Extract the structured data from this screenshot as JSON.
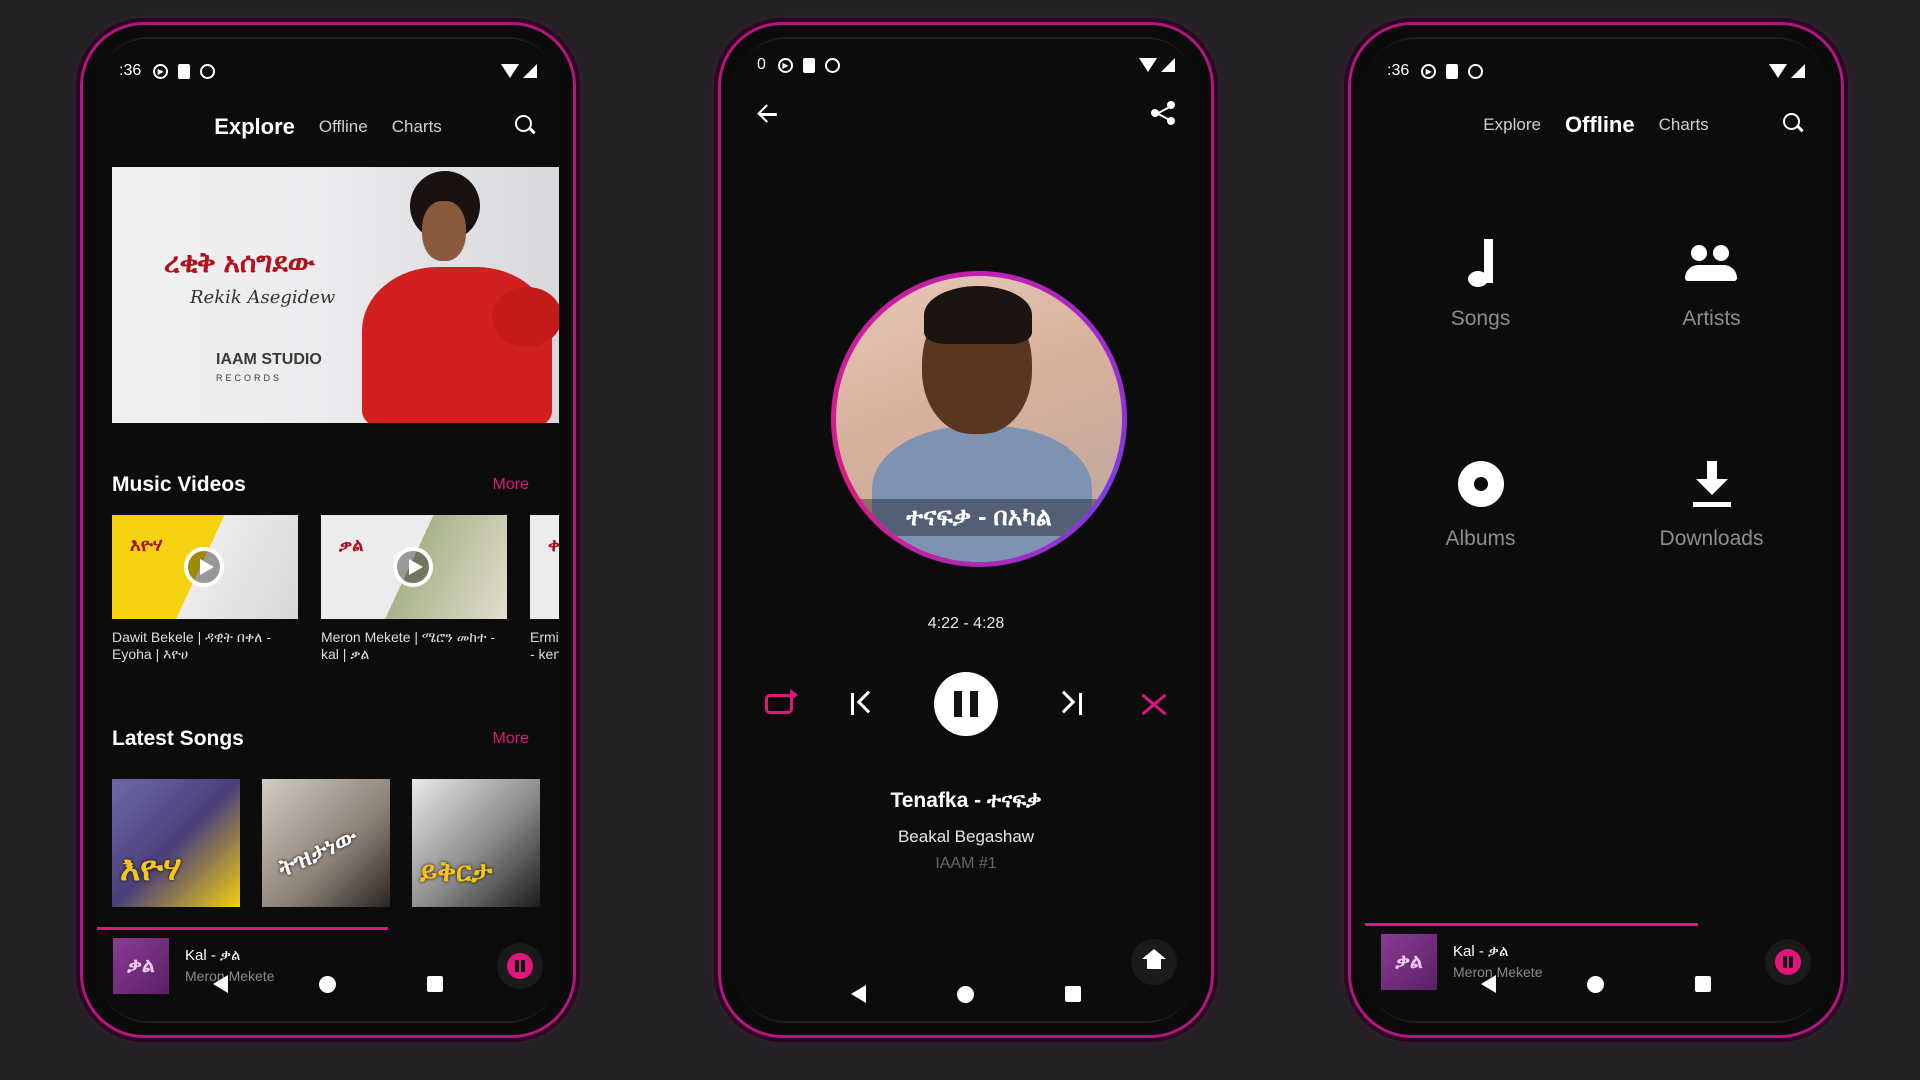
{
  "colors": {
    "accent": "#e0167c",
    "frame": "#b0177f",
    "background": "#222224"
  },
  "explore": {
    "status_time": ":36",
    "nav": {
      "explore": "Explore",
      "offline": "Offline",
      "charts": "Charts"
    },
    "banner": {
      "title_amharic": "ረቂቅ አሰግደው",
      "title_latin": "Rekik Asegidew",
      "logo": "IAAM STUDIO",
      "logo_sub": "RECORDS"
    },
    "music_videos": {
      "heading": "Music Videos",
      "more": "More",
      "items": [
        {
          "thumb_text": "እዮሃ",
          "caption": "Dawit Bekele | ዳዊት በቀለ -\nEyoha | እዮሀ"
        },
        {
          "thumb_text": "ቃል",
          "caption": "Meron Mekete | ሜሮን መከተ -\nkal | ቃል"
        },
        {
          "thumb_text": "ቀና",
          "caption": "Ermia\n- kena"
        }
      ]
    },
    "latest_songs": {
      "heading": "Latest Songs",
      "more": "More",
      "items": [
        {
          "thumb_text": "እዮሃ"
        },
        {
          "thumb_text": "ትዝታነው"
        },
        {
          "thumb_text": "ይቅርታ"
        }
      ]
    },
    "mini_player": {
      "cover_text": "ቃል",
      "title": "Kal - ቃል",
      "artist": "Meron Mekete",
      "progress": 0.63
    }
  },
  "player": {
    "status_time": "0",
    "artwork_caption": "ተናፍቃ - በአካል",
    "time": "4:22  -  4:28",
    "title": "Tenafka - ተናፍቃ",
    "artist": "Beakal Begashaw",
    "album": "IAAM #1"
  },
  "offline": {
    "status_time": ":36",
    "nav": {
      "explore": "Explore",
      "offline": "Offline",
      "charts": "Charts"
    },
    "tiles": {
      "songs": "Songs",
      "artists": "Artists",
      "albums": "Albums",
      "downloads": "Downloads"
    },
    "mini_player": {
      "cover_text": "ቃል",
      "title": "Kal - ቃል",
      "artist": "Meron Mekete",
      "progress": 0.72
    }
  }
}
